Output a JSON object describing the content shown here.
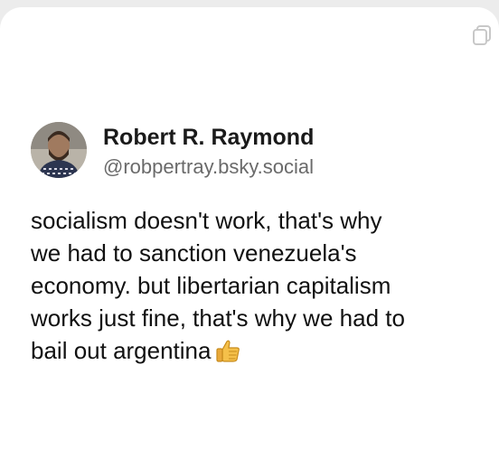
{
  "post": {
    "author": {
      "display_name": "Robert R. Raymond",
      "handle": "@robpertray.bsky.social",
      "avatar_icon": "avatar"
    },
    "lines": [
      "socialism doesn't work, that's why",
      "we had to sanction venezuela's",
      "economy. but libertarian capitalism",
      "works just fine, that's why we had to",
      "bail out argentina"
    ],
    "emoji_icon": "thumbs-up-icon"
  },
  "toolbar": {
    "copy_icon": "copy-icon"
  },
  "colors": {
    "page_background": "#ececec",
    "card_background": "#ffffff",
    "text_primary": "#111111",
    "text_secondary": "#6a6a6a",
    "emoji": "#f5c04a"
  }
}
